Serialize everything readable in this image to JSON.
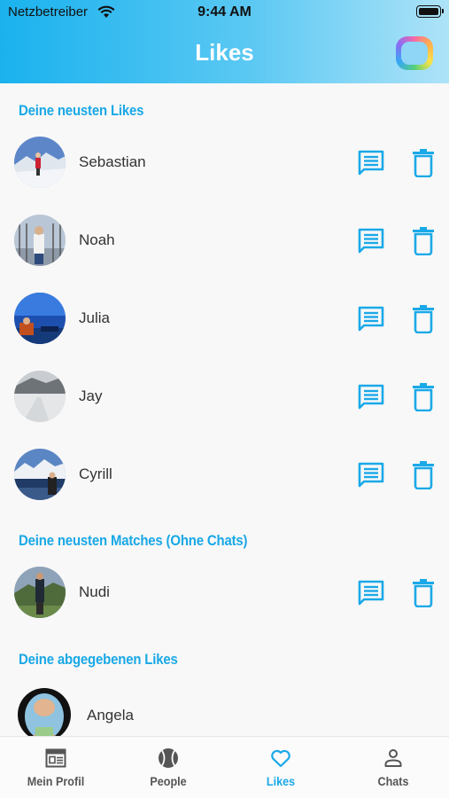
{
  "status_bar": {
    "carrier": "Netzbetreiber",
    "time": "9:44 AM"
  },
  "header": {
    "title": "Likes"
  },
  "sections": {
    "newest_likes": "Deine neusten Likes",
    "newest_matches": "Deine neusten Matches (Ohne Chats)",
    "given_likes": "Deine abgegebenen Likes"
  },
  "likes": [
    {
      "name": "Sebastian"
    },
    {
      "name": "Noah"
    },
    {
      "name": "Julia"
    },
    {
      "name": "Jay"
    },
    {
      "name": "Cyrill"
    }
  ],
  "matches": [
    {
      "name": "Nudi"
    }
  ],
  "given": [
    {
      "name": "Angela"
    }
  ],
  "tabs": [
    {
      "label": "Mein Profil",
      "icon": "profile-card-icon"
    },
    {
      "label": "People",
      "icon": "ball-icon"
    },
    {
      "label": "Likes",
      "icon": "heart-icon"
    },
    {
      "label": "Chats",
      "icon": "person-icon"
    }
  ],
  "colors": {
    "accent": "#1aa9e8",
    "header_start": "#1ab2ee",
    "header_end": "#aee3f8"
  }
}
